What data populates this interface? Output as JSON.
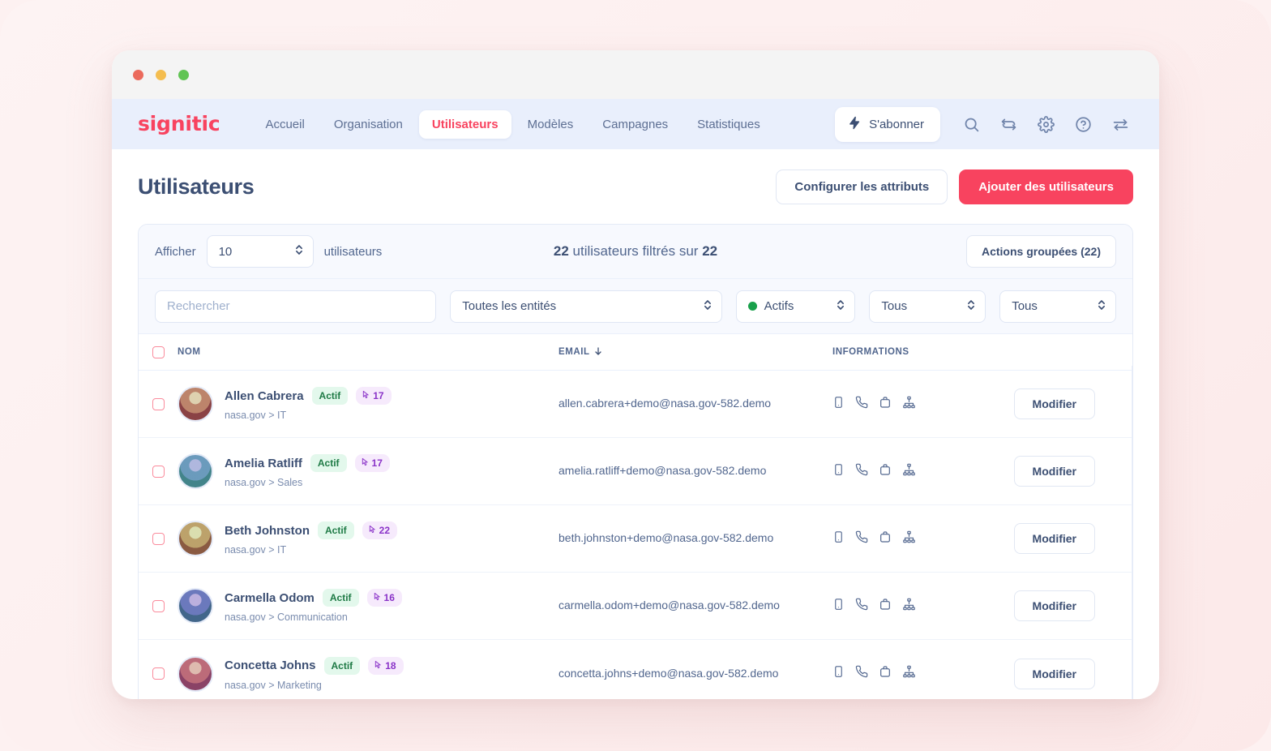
{
  "window": {
    "controls": [
      "close",
      "minimize",
      "maximize"
    ]
  },
  "navbar": {
    "logo": "signitic",
    "links": [
      {
        "label": "Accueil",
        "active": false
      },
      {
        "label": "Organisation",
        "active": false
      },
      {
        "label": "Utilisateurs",
        "active": true
      },
      {
        "label": "Modèles",
        "active": false
      },
      {
        "label": "Campagnes",
        "active": false
      },
      {
        "label": "Statistiques",
        "active": false
      }
    ],
    "subscribe_label": "S'abonner",
    "icons": [
      "search-icon",
      "refresh-icon",
      "gear-icon",
      "help-icon",
      "transfer-icon"
    ],
    "accent_color": "#f8435f",
    "background_color": "#e9effc"
  },
  "page": {
    "title": "Utilisateurs",
    "configure_attributes_label": "Configurer les attributs",
    "add_users_label": "Ajouter des utilisateurs"
  },
  "toolbar": {
    "show_label": "Afficher",
    "page_size": "10",
    "users_label": "utilisateurs",
    "filter_count_prefix": "22",
    "filter_count_middle": "utilisateurs filtrés sur",
    "filter_count_suffix": "22",
    "bulk_actions_label": "Actions groupées (22)"
  },
  "filters": {
    "search_placeholder": "Rechercher",
    "search_value": "",
    "entity_select": "Toutes les entités",
    "status_select": "Actifs",
    "status_color": "#18a04a",
    "third_select": "Tous",
    "fourth_select": "Tous"
  },
  "table": {
    "headers": {
      "name": "NOM",
      "email": "EMAIL",
      "informations": "INFORMATIONS",
      "sort_icon": "arrow-down-icon"
    },
    "info_icons": [
      "mobile-icon",
      "phone-icon",
      "briefcase-icon",
      "hierarchy-icon"
    ],
    "edit_label": "Modifier",
    "rows": [
      {
        "name": "Allen Cabrera",
        "status": "Actif",
        "clicks": "17",
        "org": "nasa.gov > IT",
        "email": "allen.cabrera+demo@nasa.gov-582.demo",
        "avatar_hue": 18
      },
      {
        "name": "Amelia Ratliff",
        "status": "Actif",
        "clicks": "17",
        "org": "nasa.gov > Sales",
        "email": "amelia.ratliff+demo@nasa.gov-582.demo",
        "avatar_hue": 205
      },
      {
        "name": "Beth Johnston",
        "status": "Actif",
        "clicks": "22",
        "org": "nasa.gov > IT",
        "email": "beth.johnston+demo@nasa.gov-582.demo",
        "avatar_hue": 40
      },
      {
        "name": "Carmella Odom",
        "status": "Actif",
        "clicks": "16",
        "org": "nasa.gov > Communication",
        "email": "carmella.odom+demo@nasa.gov-582.demo",
        "avatar_hue": 230
      },
      {
        "name": "Concetta Johns",
        "status": "Actif",
        "clicks": "18",
        "org": "nasa.gov > Marketing",
        "email": "concetta.johns+demo@nasa.gov-582.demo",
        "avatar_hue": 350
      }
    ]
  }
}
